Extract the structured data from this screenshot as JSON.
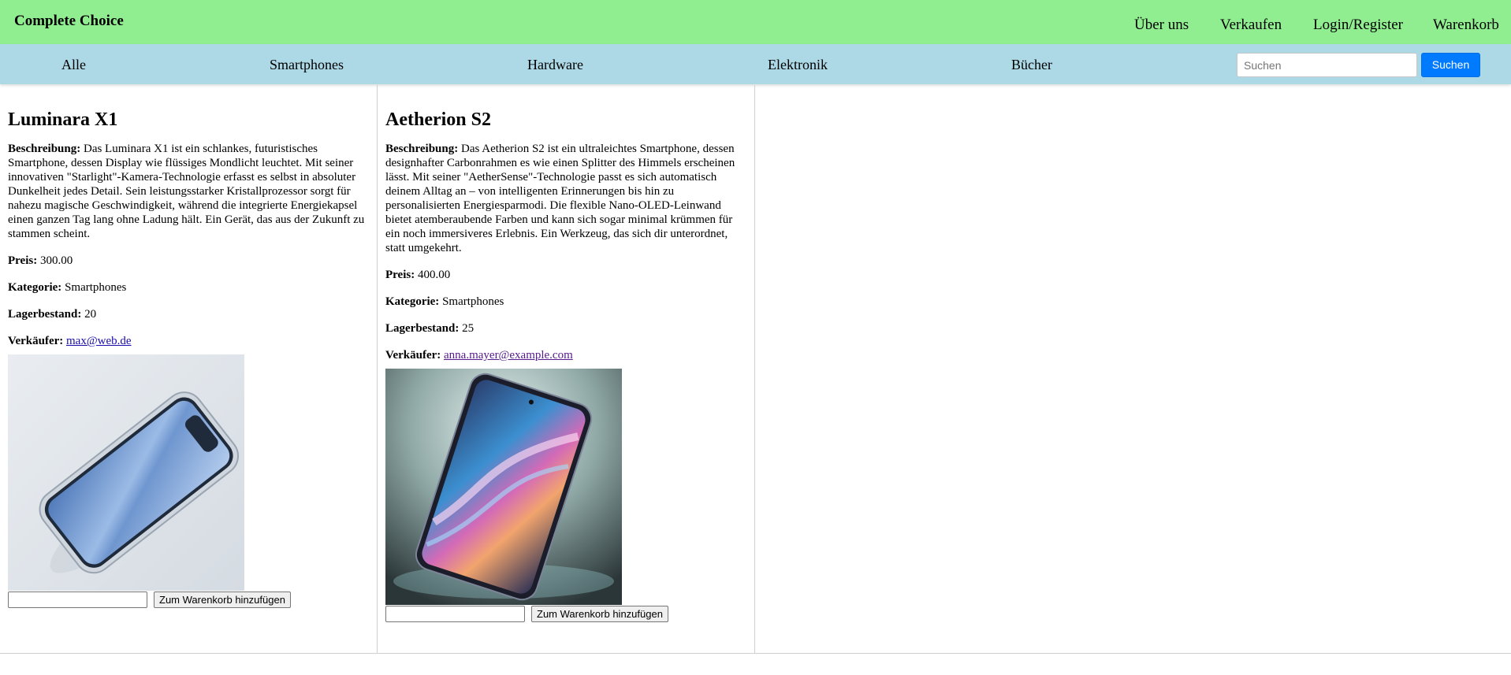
{
  "header": {
    "brand": "Complete Choice",
    "nav": {
      "about": "Über uns",
      "sell": "Verkaufen",
      "login": "Login/Register",
      "cart": "Warenkorb"
    }
  },
  "categories": {
    "all": "Alle",
    "smartphones": "Smartphones",
    "hardware": "Hardware",
    "electronics": "Elektronik",
    "books": "Bücher"
  },
  "search": {
    "placeholder": "Suchen",
    "value": "",
    "button_label": "Suchen"
  },
  "labels": {
    "description": "Beschreibung:",
    "price": "Preis:",
    "category": "Kategorie:",
    "stock": "Lagerbestand:",
    "seller": "Verkäufer:",
    "add_to_cart": "Zum Warenkorb hinzufügen"
  },
  "products": [
    {
      "name": "Luminara X1",
      "description": "Das Luminara X1 ist ein schlankes, futuristisches Smartphone, dessen Display wie flüssiges Mondlicht leuchtet. Mit seiner innovativen \"Starlight\"-Kamera-Technologie erfasst es selbst in absoluter Dunkelheit jedes Detail. Sein leistungsstarker Kristallprozessor sorgt für nahezu magische Geschwindigkeit, während die integrierte Energiekapsel einen ganzen Tag lang ohne Ladung hält. Ein Gerät, das aus der Zukunft zu stammen scheint.",
      "price": "300.00",
      "category": "Smartphones",
      "stock": "20",
      "seller": "max@web.de",
      "quantity": "",
      "image_icon": "smartphone-product-photo"
    },
    {
      "name": "Aetherion S2",
      "description": "Das Aetherion S2 ist ein ultraleichtes Smartphone, dessen designhafter Carbonrahmen es wie einen Splitter des Himmels erscheinen lässt. Mit seiner \"AetherSense\"-Technologie passt es sich automatisch deinem Alltag an – von intelligenten Erinnerungen bis hin zu personalisierten Energiesparmodi. Die flexible Nano-OLED-Leinwand bietet atemberaubende Farben und kann sich sogar minimal krümmen für ein noch immersiveres Erlebnis. Ein Werkzeug, das sich dir unterordnet, statt umgekehrt.",
      "price": "400.00",
      "category": "Smartphones",
      "stock": "25",
      "seller": "anna.mayer@example.com",
      "quantity": "",
      "image_icon": "smartphone-product-photo"
    }
  ],
  "colors": {
    "topbar": "#90ee90",
    "category_bar": "#add8e6",
    "search_button": "#007bff"
  }
}
